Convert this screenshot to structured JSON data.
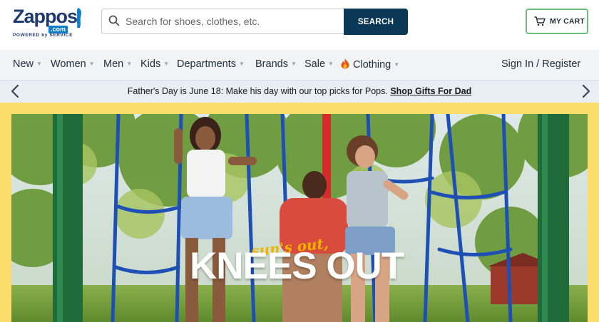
{
  "brand": {
    "name": "Zappos",
    "domain_badge": ".com",
    "tagline": "POWERED by SERVICE",
    "colors": {
      "primary": "#1f3a6e",
      "accent": "#0f7fcb",
      "search_button": "#0b3854",
      "cart_border": "#6cbf7a",
      "hero_border": "#fadc6a"
    }
  },
  "search": {
    "placeholder": "Search for shoes, clothes, etc.",
    "value": "",
    "button_label": "SEARCH",
    "icon": "search-icon"
  },
  "cart": {
    "label": "MY CART",
    "icon": "cart-icon"
  },
  "nav": {
    "items": [
      {
        "label": "New"
      },
      {
        "label": "Women"
      },
      {
        "label": "Men"
      },
      {
        "label": "Kids"
      },
      {
        "label": "Departments"
      },
      {
        "label": "Brands"
      },
      {
        "label": "Sale"
      },
      {
        "label": "Clothing",
        "icon": "flame-icon"
      }
    ],
    "account": "Sign In / Register"
  },
  "promo": {
    "text": "Father's Day is June 18: Make his day with our top picks for Pops.",
    "link": "Shop Gifts For Dad",
    "prev_icon": "chevron-left-icon",
    "next_icon": "chevron-right-icon"
  },
  "hero": {
    "kicker": "sun's out,",
    "headline": "KNEES OUT"
  }
}
